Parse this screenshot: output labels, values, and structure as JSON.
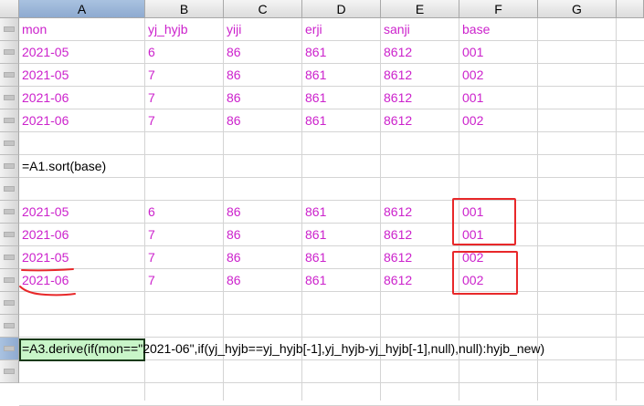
{
  "columns": [
    "A",
    "B",
    "C",
    "D",
    "E",
    "F",
    "G"
  ],
  "rows": [
    {
      "n": "1",
      "cells": [
        "mon",
        "yj_hyjb",
        "yiji",
        "erji",
        "sanji",
        "base",
        ""
      ]
    },
    {
      "n": "2",
      "cells": [
        "2021-05",
        "6",
        "86",
        "861",
        "8612",
        "001",
        ""
      ]
    },
    {
      "n": "3",
      "cells": [
        "2021-05",
        "7",
        "86",
        "861",
        "8612",
        "002",
        ""
      ]
    },
    {
      "n": "4",
      "cells": [
        "2021-06",
        "7",
        "86",
        "861",
        "8612",
        "001",
        ""
      ]
    },
    {
      "n": "5",
      "cells": [
        "2021-06",
        "7",
        "86",
        "861",
        "8612",
        "002",
        ""
      ]
    },
    {
      "n": "6",
      "cells": [
        "",
        "",
        "",
        "",
        "",
        "",
        ""
      ]
    },
    {
      "n": "7",
      "cells": [
        "=A1.sort(base)",
        "",
        "",
        "",
        "",
        "",
        ""
      ]
    },
    {
      "n": "8",
      "cells": [
        "",
        "",
        "",
        "",
        "",
        "",
        ""
      ]
    },
    {
      "n": "9",
      "cells": [
        "2021-05",
        "6",
        "86",
        "861",
        "8612",
        "001",
        ""
      ]
    },
    {
      "n": "10",
      "cells": [
        "2021-06",
        "7",
        "86",
        "861",
        "8612",
        "001",
        ""
      ]
    },
    {
      "n": "11",
      "cells": [
        "2021-05",
        "7",
        "86",
        "861",
        "8612",
        "002",
        ""
      ]
    },
    {
      "n": "12",
      "cells": [
        "2021-06",
        "7",
        "86",
        "861",
        "8612",
        "002",
        ""
      ]
    },
    {
      "n": "13",
      "cells": [
        "",
        "",
        "",
        "",
        "",
        "",
        ""
      ]
    },
    {
      "n": "14",
      "cells": [
        "",
        "",
        "",
        "",
        "",
        "",
        ""
      ]
    },
    {
      "n": "15",
      "cells": [
        "=A3.derive(if(mon==\"2021-06\",if(yj_hyjb==yj_hyjb[-1],yj_hyjb-yj_hyjb[-1],null),null):hyjb_new)",
        "",
        "",
        "",
        "",
        "",
        ""
      ]
    },
    {
      "n": "16",
      "cells": [
        "",
        "",
        "",
        "",
        "",
        "",
        ""
      ]
    }
  ],
  "selection": {
    "column": "A",
    "row": "15"
  },
  "annotation_color": "#e8282a",
  "text_colors": {
    "data": "#cc22cc",
    "formula": "#000000"
  }
}
